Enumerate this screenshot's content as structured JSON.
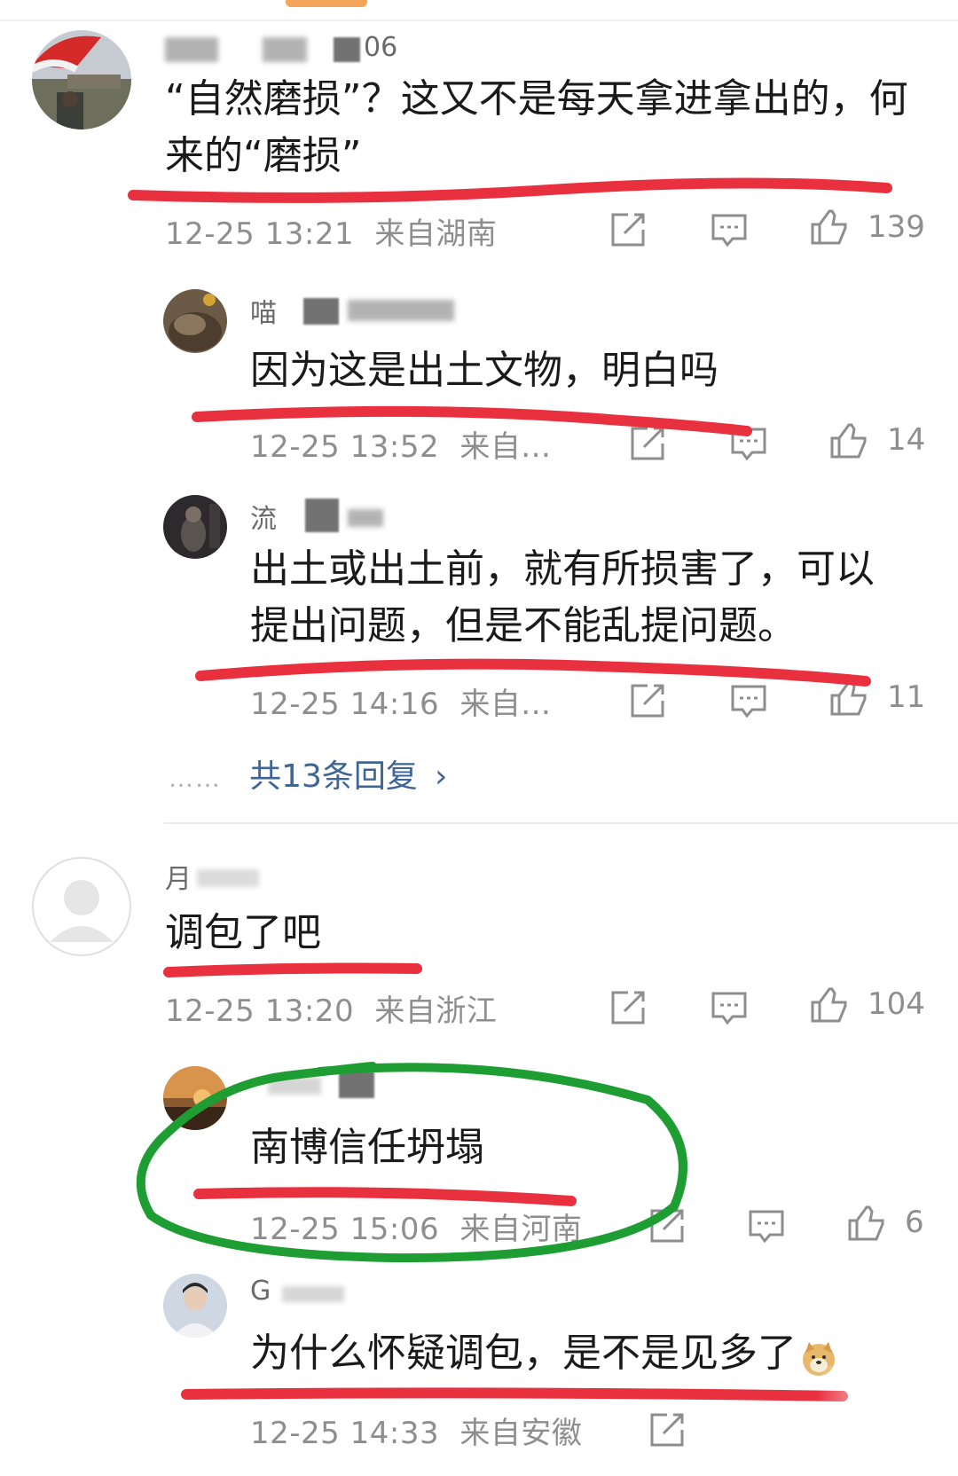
{
  "comments": [
    {
      "user": "06",
      "text": "“自然磨损”？这又不是每天拿进拿出的，何来的“磨损”",
      "text_line1": "“自然磨损”？这又不是每天拿进拿出的，何",
      "text_line2": "来的“磨损”",
      "time": "12-25 13:21",
      "location": "来自湖南",
      "likes": "139"
    },
    {
      "user": "喵",
      "text": "因为这是出土文物，明白吗",
      "time": "12-25 13:52",
      "location": "来自...",
      "likes": "14"
    },
    {
      "user": "流",
      "text": "出土或出土前，就有所损害了，可以提出问题，但是不能乱提问题。",
      "text_line1": "出土或出土前，就有所损害了，可以",
      "text_line2": "提出问题，但是不能乱提问题。",
      "time": "12-25 14:16",
      "location": "来自...",
      "likes": "11"
    },
    {
      "user": "月",
      "text": "调包了吧",
      "time": "12-25 13:20",
      "location": "来自浙江",
      "likes": "104"
    },
    {
      "user": "",
      "text": "南博信任坍塌",
      "time": "12-25 15:06",
      "location": "来自河南",
      "likes": "6"
    },
    {
      "user": "G",
      "text": "为什么怀疑调包，是不是见多了",
      "time": "12-25 14:33",
      "location": "来自安徽",
      "likes": ""
    }
  ],
  "more_replies": {
    "dots": "……",
    "label": "共13条回复",
    "arrow": "›"
  },
  "icons": [
    "share-icon",
    "comment-icon",
    "like-icon",
    "avatar-default-icon",
    "doge-emoji"
  ],
  "colors": {
    "meta_gray": "#8e8e8e",
    "link_blue": "#3f6496",
    "red_underline": "#e8303e",
    "green_circle": "#1e9e32"
  }
}
